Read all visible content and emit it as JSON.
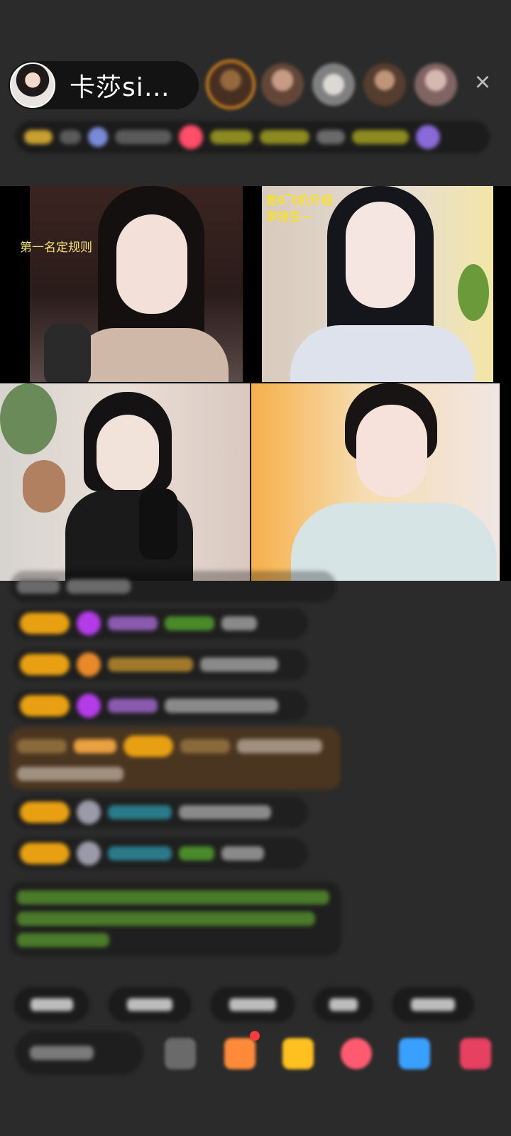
{
  "host": {
    "name": "卡莎si…",
    "avatar_icon": "host-avatar-icon"
  },
  "viewers": [
    {
      "color": "#7a5a3a"
    },
    {
      "color": "#b58a7a"
    },
    {
      "color": "#dcd2cc"
    },
    {
      "color": "#a07860"
    },
    {
      "color": "#d8b0b0"
    }
  ],
  "close_icon": "×",
  "ticker": {
    "colors": [
      "#c8a030",
      "#5a5a5a",
      "#7a8ad8",
      "#5a5a5a",
      "#ff4d6a",
      "#c8c020",
      "#c8c020",
      "#8a8a8a",
      "#d8d020",
      "#8a6ad8"
    ]
  },
  "streams": [
    {
      "caption": "第一名定规则",
      "caption_color": "#f6e27a",
      "theme": "#3a2a28"
    },
    {
      "caption": "差6飞机升级\n求接生~",
      "caption_color": "#ffe600",
      "theme": "#d8cfc4"
    },
    {
      "caption": "",
      "theme": "#e4dcd6"
    },
    {
      "caption": "",
      "theme": "#f3b06a"
    }
  ],
  "chat": {
    "gold": "#e8a012",
    "purple": "#b43ce8",
    "teal": "#3aa0b0",
    "green": "#6ab820"
  },
  "quick_replies": [
    {
      "width": 106,
      "bar": 60
    },
    {
      "width": 118,
      "bar": 64
    },
    {
      "width": 120,
      "bar": 66
    },
    {
      "width": 84,
      "bar": 40
    },
    {
      "width": 116,
      "bar": 62
    }
  ],
  "toolbar": {
    "colors": [
      "#7a7a7a",
      "#ff8a3a",
      "#ffcc30",
      "#ff5a70",
      "#3aa0ff",
      "#e84060"
    ]
  }
}
